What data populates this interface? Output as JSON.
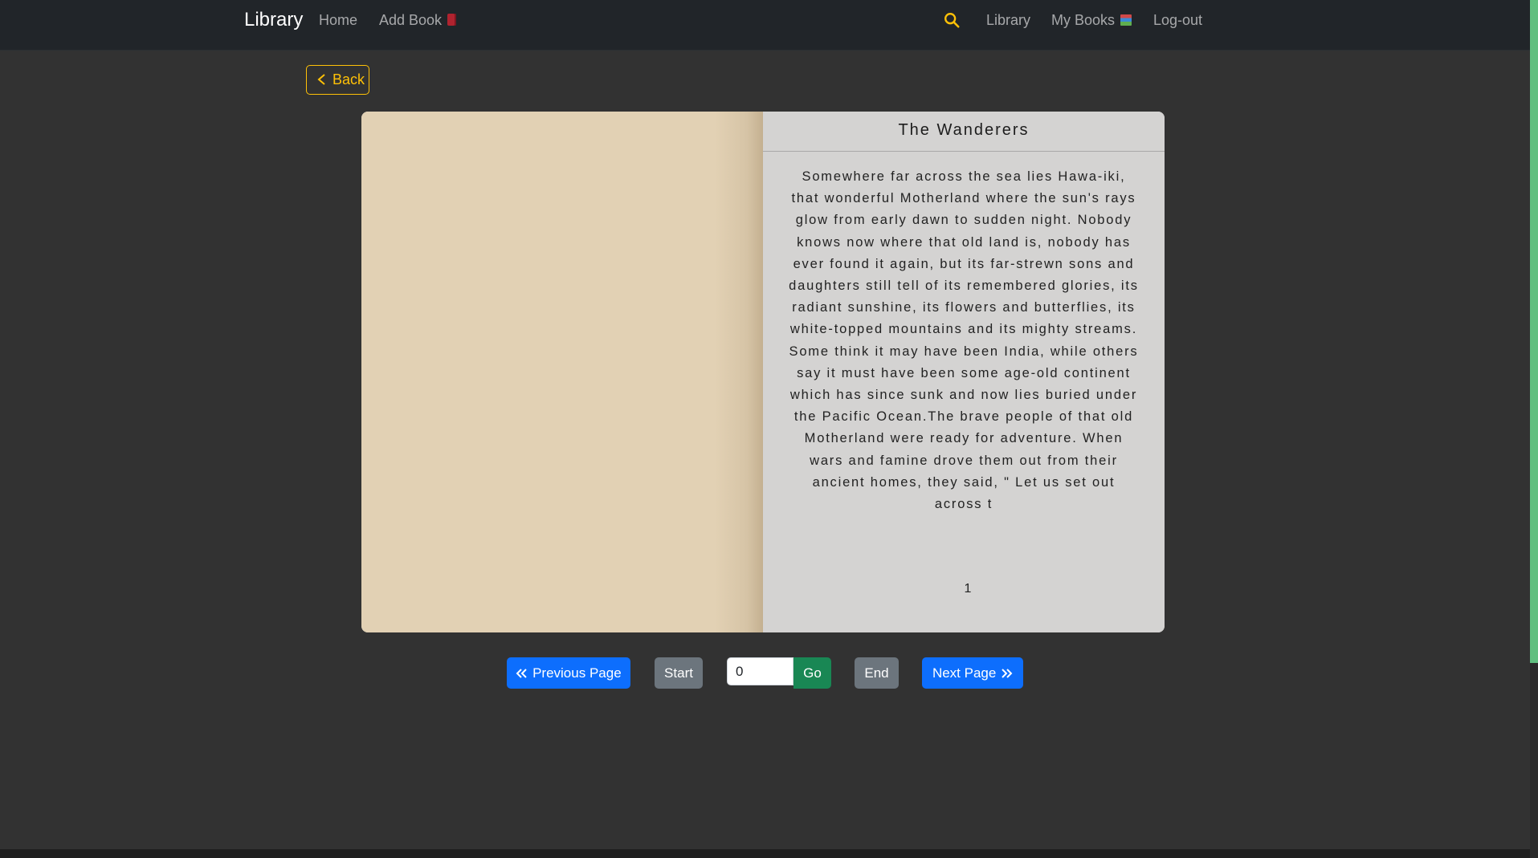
{
  "navbar": {
    "brand": "Library",
    "home": "Home",
    "add_book": "Add Book",
    "library": "Library",
    "my_books": "My Books",
    "logout": "Log-out",
    "accent_color": "#ffc107"
  },
  "back": {
    "label": "Back"
  },
  "book": {
    "title": "The Wanderers",
    "text": "Somewhere far across the sea lies Hawa-iki, that wonderful Motherland where the sun's rays glow from early dawn to sudden night. Nobody knows now where that old land is, nobody has ever found it again, but its far-strewn sons and daughters still tell of its remembered glories, its radiant sunshine, its flowers and butterflies, its white-topped mountains and its mighty streams. Some think it may have been India, while others say it must have been some age-old continent which has since sunk and now lies buried under the Pacific Ocean.The brave people of that old Motherland were ready for adventure. When wars and famine drove them out from their ancient homes, they said, \" Let us set out across t",
    "page_number": "1"
  },
  "pagination": {
    "previous_label": "Previous Page",
    "start_label": "Start",
    "page_input_value": "0",
    "go_label": "Go",
    "end_label": "End",
    "next_label": "Next Page"
  }
}
